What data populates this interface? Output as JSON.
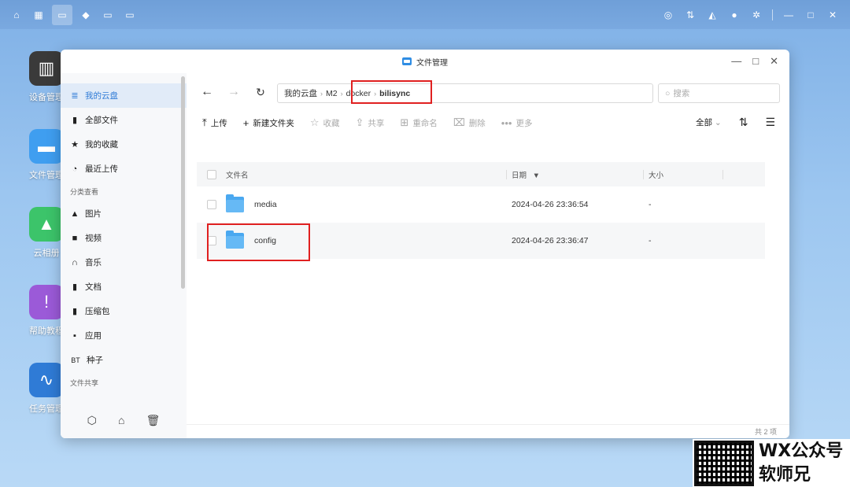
{
  "window": {
    "title": "文件管理"
  },
  "desktop": [
    {
      "label": "设备管理"
    },
    {
      "label": "文件管理"
    },
    {
      "label": "云相册"
    },
    {
      "label": "帮助教程"
    },
    {
      "label": "任务管理"
    }
  ],
  "sidebar": {
    "items": [
      {
        "label": "我的云盘",
        "icon": "list-icon",
        "glyph": "≣"
      },
      {
        "label": "全部文件",
        "icon": "file-icon",
        "glyph": "▮"
      },
      {
        "label": "我的收藏",
        "icon": "star-icon",
        "glyph": "★"
      },
      {
        "label": "最近上传",
        "icon": "clock-icon",
        "glyph": "◔"
      }
    ],
    "category_title": "分类查看",
    "categories": [
      {
        "label": "图片",
        "icon": "image-icon",
        "glyph": "▲"
      },
      {
        "label": "视频",
        "icon": "video-icon",
        "glyph": "■"
      },
      {
        "label": "音乐",
        "icon": "headphones-icon",
        "glyph": "∩"
      },
      {
        "label": "文档",
        "icon": "document-icon",
        "glyph": "▮"
      },
      {
        "label": "压缩包",
        "icon": "archive-icon",
        "glyph": "▮"
      },
      {
        "label": "应用",
        "icon": "apps-icon",
        "glyph": "▪"
      },
      {
        "label": "种子",
        "icon": "bt-icon",
        "glyph": "BT"
      }
    ],
    "share_title": "文件共享"
  },
  "breadcrumb": [
    "我的云盘",
    "M2",
    "docker",
    "bilisync"
  ],
  "search": {
    "placeholder": "搜索"
  },
  "toolbar": {
    "upload": "上传",
    "new_folder": "新建文件夹",
    "favorite": "收藏",
    "share": "共享",
    "rename": "重命名",
    "delete": "删除",
    "more": "更多",
    "filter": "全部"
  },
  "table": {
    "headers": {
      "name": "文件名",
      "date": "日期",
      "size": "大小"
    },
    "rows": [
      {
        "name": "media",
        "date": "2024-04-26 23:36:54",
        "size": "-"
      },
      {
        "name": "config",
        "date": "2024-04-26 23:36:47",
        "size": "-"
      }
    ]
  },
  "footer": {
    "count": "共 2 项"
  },
  "watermark": {
    "line1": "WX公众号",
    "line2": "软师兄"
  }
}
